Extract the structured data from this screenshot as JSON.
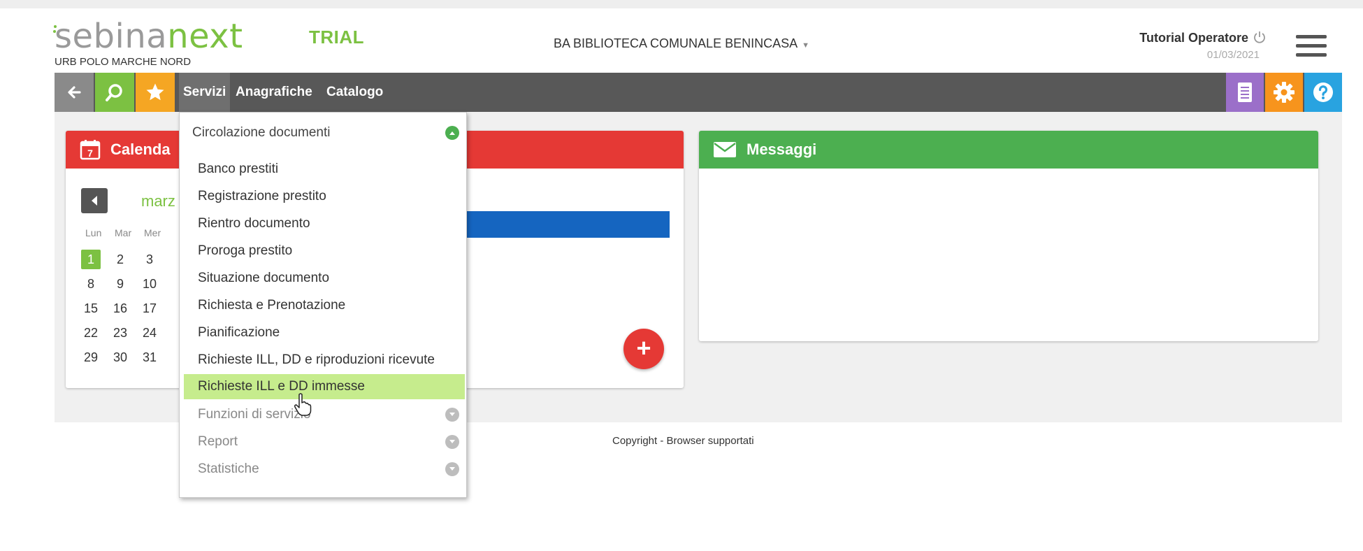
{
  "header": {
    "logo_part1": "sebina",
    "logo_part2": "next",
    "trial": "TRIAL",
    "polo": "URB POLO MARCHE NORD",
    "library": "BA BIBLIOTECA COMUNALE BENINCASA",
    "operator": "Tutorial Operatore",
    "date": "01/03/2021"
  },
  "navbar": {
    "menus": [
      "Servizi",
      "Anagrafiche",
      "Catalogo"
    ],
    "active_menu": "Servizi"
  },
  "calendar": {
    "title": "Calenda",
    "month": "marz",
    "weekdays": [
      "Lun",
      "Mar",
      "Mer"
    ],
    "weeks": [
      [
        "1",
        "2",
        "3"
      ],
      [
        "8",
        "9",
        "10"
      ],
      [
        "15",
        "16",
        "17"
      ],
      [
        "22",
        "23",
        "24"
      ],
      [
        "29",
        "30",
        "31"
      ]
    ],
    "today": "1",
    "add_label": "+"
  },
  "messages": {
    "title": "Messaggi"
  },
  "dropdown": {
    "header": "Circolazione documenti",
    "items": [
      "Banco prestiti",
      "Registrazione prestito",
      "Rientro documento",
      "Proroga prestito",
      "Situazione documento",
      "Richiesta e Prenotazione",
      "Pianificazione",
      "Richieste ILL, DD e riproduzioni ricevute",
      "Richieste ILL e DD immesse"
    ],
    "hovered_item": "Richieste ILL e DD immesse",
    "sections": [
      "Funzioni di servizio",
      "Report",
      "Statistiche"
    ]
  },
  "footer": {
    "copyright": "Copyright",
    "separator": " - ",
    "browsers": "Browser supportati"
  },
  "colors": {
    "brand_green": "#7cc142",
    "calendar_red": "#e53935",
    "messages_green": "#4caf50",
    "nav_dark": "#585858",
    "hover_green": "#c6ec8d"
  }
}
